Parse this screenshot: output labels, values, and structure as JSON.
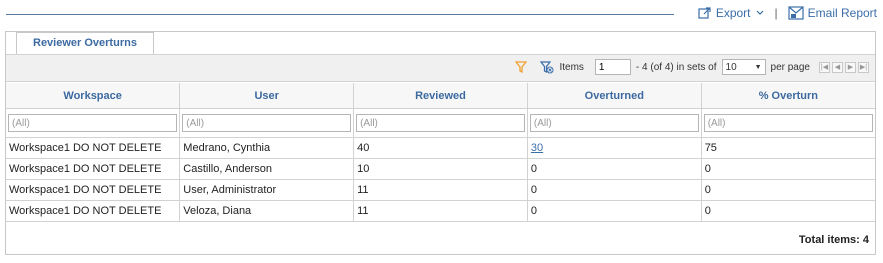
{
  "header": {
    "export_label": "Export",
    "separator": "|",
    "email_report_label": "Email Report"
  },
  "tabs": [
    {
      "label": "Reviewer Overturns"
    }
  ],
  "pager": {
    "items_label": "Items",
    "page_value": "1",
    "range_text": "- 4 (of 4) in sets of",
    "page_size": "10",
    "per_page_label": "per page"
  },
  "columns": [
    "Workspace",
    "User",
    "Reviewed",
    "Overturned",
    "% Overturn"
  ],
  "filters": [
    "(All)",
    "(All)",
    "(All)",
    "(All)",
    "(All)"
  ],
  "rows": [
    {
      "workspace": "Workspace1 DO NOT DELETE",
      "user": "Medrano, Cynthia",
      "reviewed": "40",
      "overturned": "30",
      "pct": "75"
    },
    {
      "workspace": "Workspace1 DO NOT DELETE",
      "user": "Castillo, Anderson",
      "reviewed": "10",
      "overturned": "0",
      "pct": "0"
    },
    {
      "workspace": "Workspace1 DO NOT DELETE",
      "user": "User, Administrator",
      "reviewed": "11",
      "overturned": "0",
      "pct": "0"
    },
    {
      "workspace": "Workspace1 DO NOT DELETE",
      "user": "Veloza, Diana",
      "reviewed": "11",
      "overturned": "0",
      "pct": "0"
    }
  ],
  "footer": {
    "total_label": "Total items: 4"
  },
  "colors": {
    "accent": "#3b6ea8",
    "filter_icon": "#f0a030"
  }
}
